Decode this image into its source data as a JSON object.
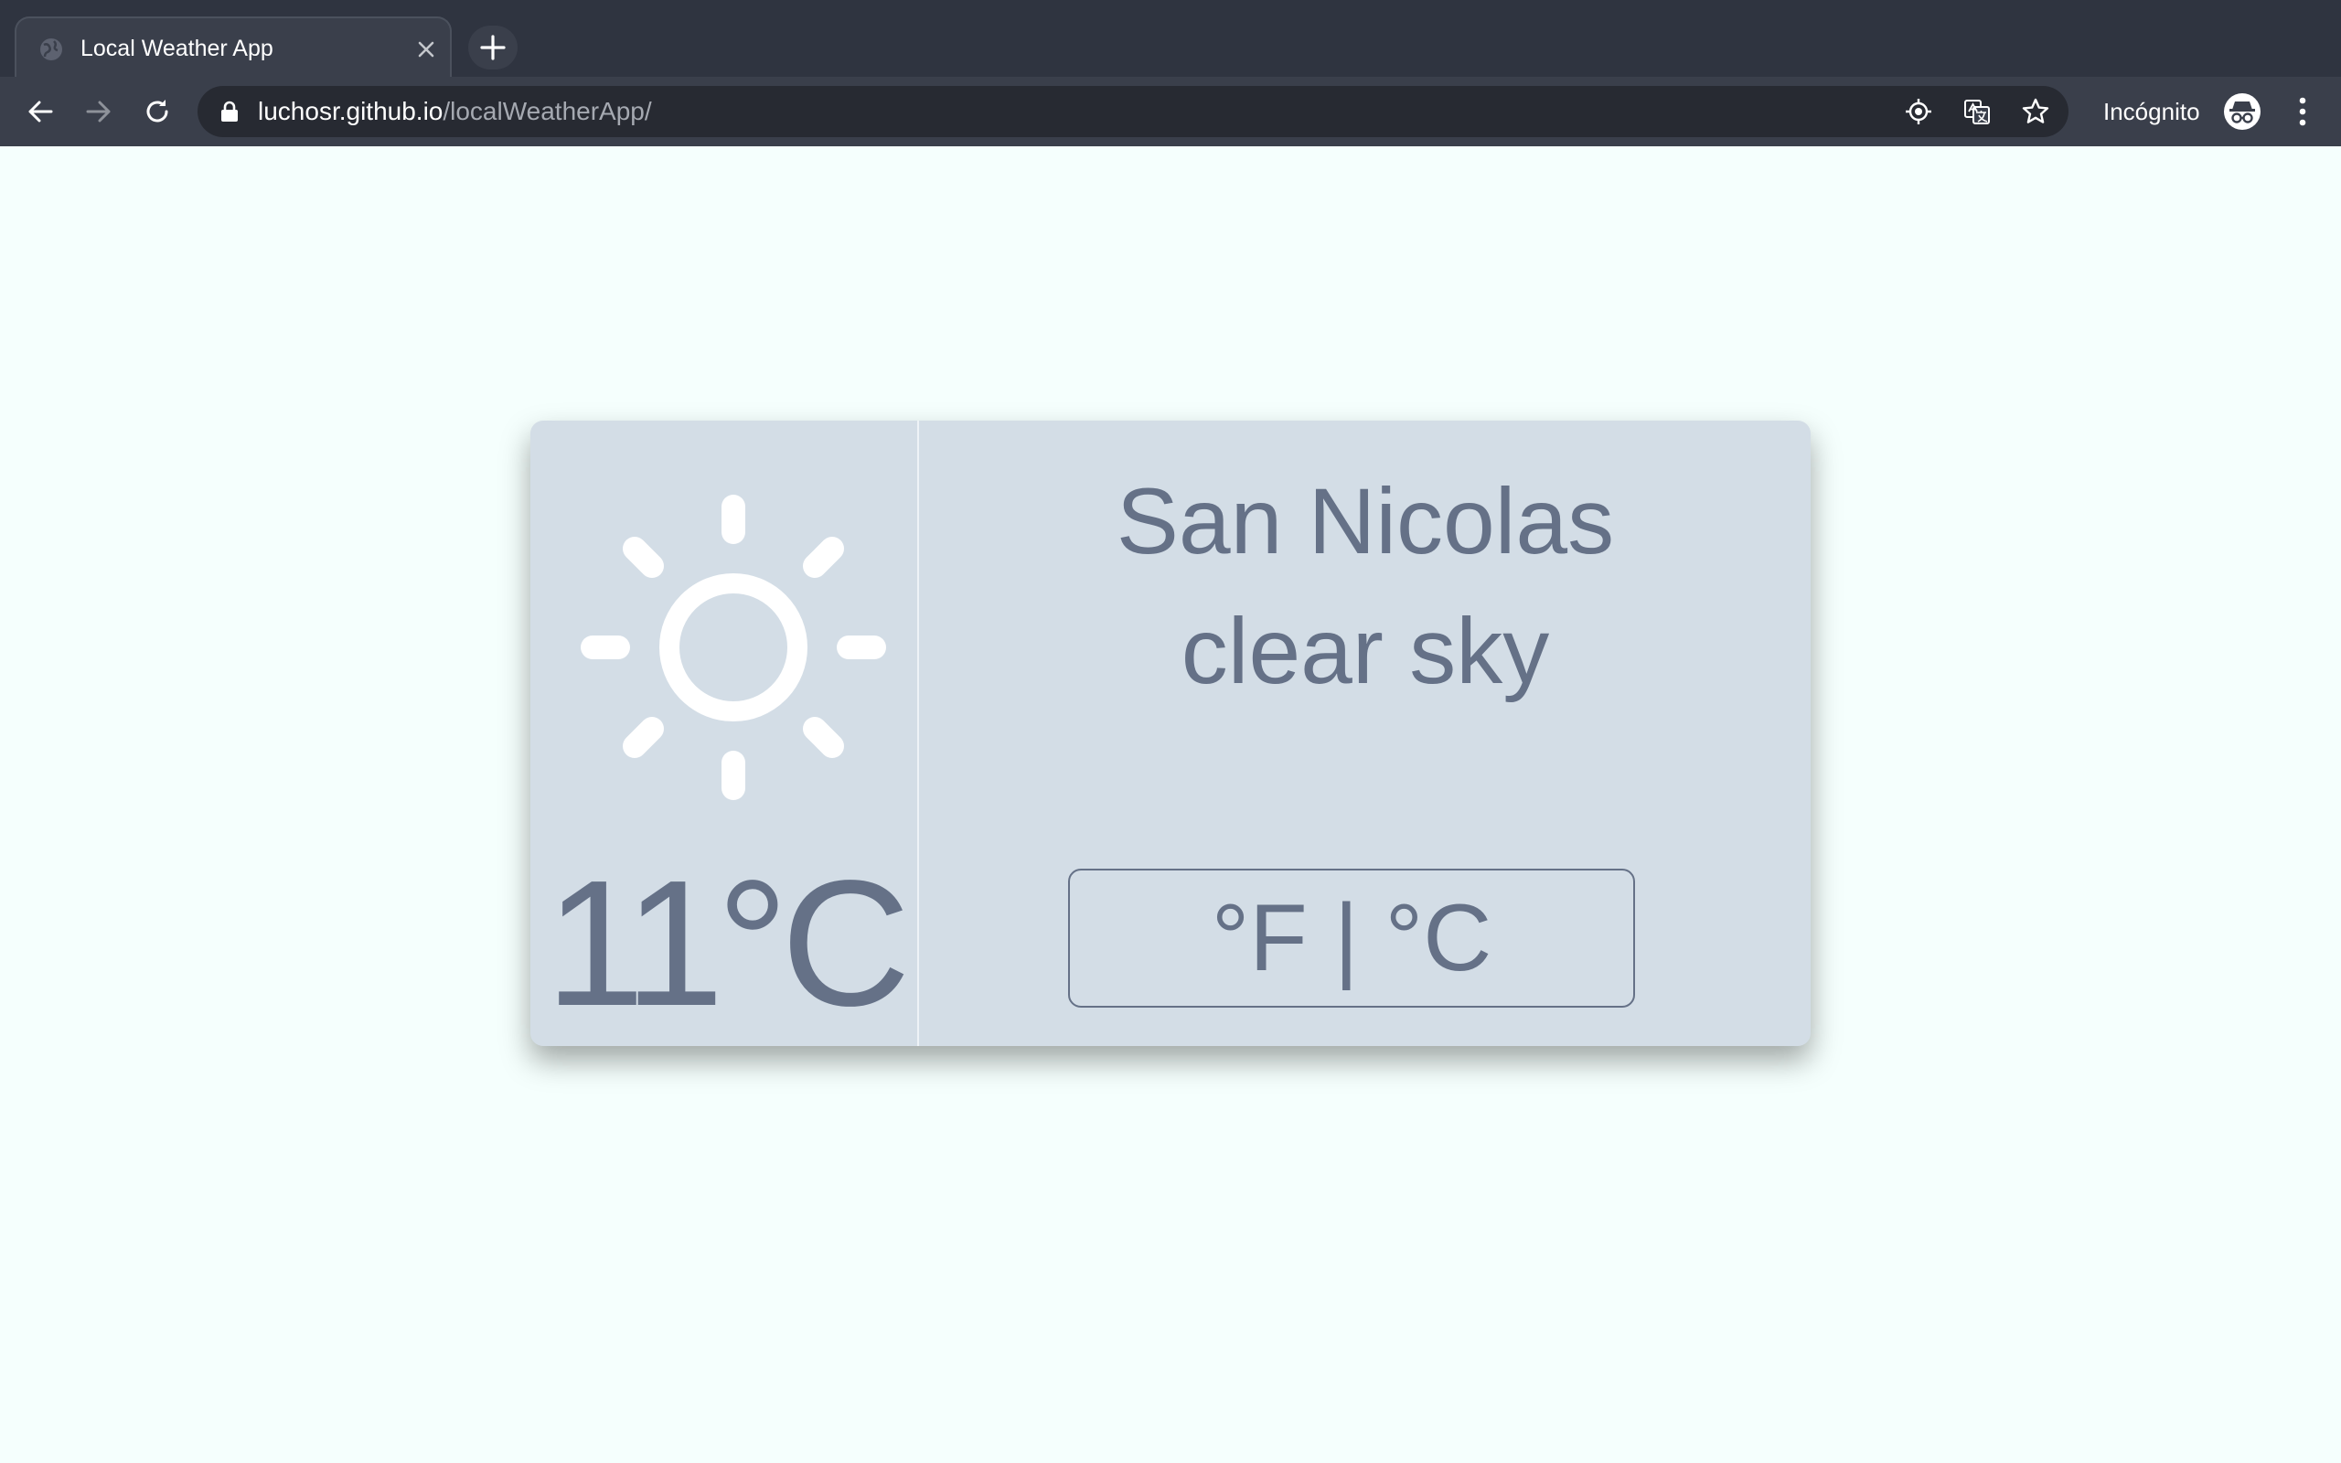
{
  "browser": {
    "tab": {
      "title": "Local Weather App",
      "favicon": "globe-icon",
      "close_icon": "close-icon"
    },
    "new_tab_icon": "plus-icon",
    "nav": {
      "back_icon": "arrow-left-icon",
      "forward_icon": "arrow-right-icon",
      "reload_icon": "reload-icon"
    },
    "address": {
      "host": "luchosr.github.io",
      "path": "/localWeatherApp/",
      "lock_icon": "lock-icon"
    },
    "omnibox_icons": [
      "location-target-icon",
      "translate-icon",
      "star-icon"
    ],
    "profile": {
      "label": "Incógnito",
      "icon": "incognito-icon"
    },
    "menu_icon": "kebab-menu-icon",
    "colors": {
      "tab_strip": "#2f3440",
      "toolbar": "#3a3f4b",
      "omnibox": "#272a32"
    }
  },
  "weather": {
    "icon": "sun-icon",
    "temperature": "11°C",
    "city": "San Nicolas",
    "condition": "clear sky",
    "unit_toggle_label": "°F | °C",
    "colors": {
      "page_bg": "#f5fffd",
      "card_bg": "#d3dde6",
      "text": "#657187",
      "icon": "#ffffff"
    }
  }
}
